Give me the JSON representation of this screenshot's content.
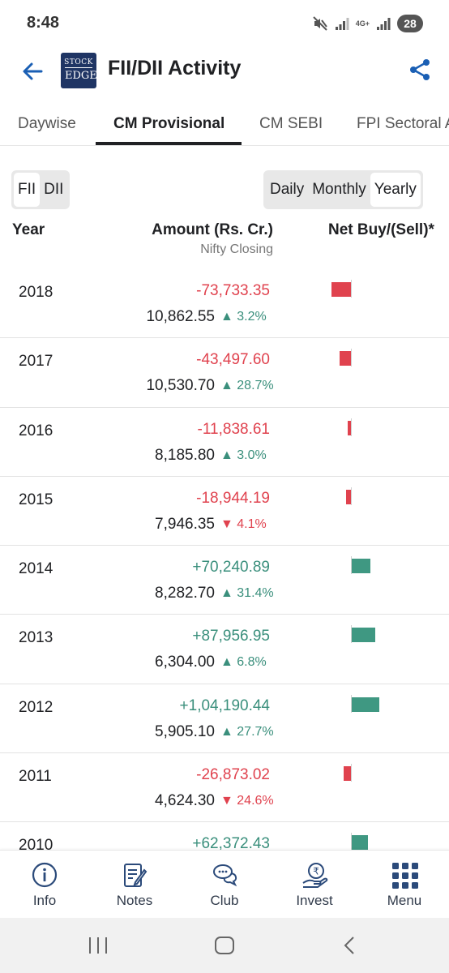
{
  "status": {
    "time": "8:48",
    "network": "4G+",
    "battery": "28"
  },
  "appbar": {
    "title": "FII/DII Activity",
    "logo_line1": "STOCK",
    "logo_line2": "EDGE"
  },
  "tabs": [
    {
      "label": "Daywise",
      "active": false
    },
    {
      "label": "CM Provisional",
      "active": true
    },
    {
      "label": "CM SEBI",
      "active": false
    },
    {
      "label": "FPI Sectoral Analysis",
      "active": false
    }
  ],
  "investor_toggle": {
    "options": [
      "FII",
      "DII"
    ],
    "selected": "FII"
  },
  "period_toggle": {
    "options": [
      "Daily",
      "Monthly",
      "Yearly"
    ],
    "selected": "Yearly"
  },
  "table": {
    "col_year": "Year",
    "col_amount": "Amount (Rs. Cr.)",
    "col_amount_sub": "Nifty Closing",
    "col_net": "Net Buy/(Sell)*",
    "rows": [
      {
        "year": "2018",
        "amount": "-73,733.35",
        "amount_value": -73733.35,
        "nifty": "10,862.55",
        "change": "▲ 3.2%",
        "direction": "up"
      },
      {
        "year": "2017",
        "amount": "-43,497.60",
        "amount_value": -43497.6,
        "nifty": "10,530.70",
        "change": "▲ 28.7%",
        "direction": "up"
      },
      {
        "year": "2016",
        "amount": "-11,838.61",
        "amount_value": -11838.61,
        "nifty": "8,185.80",
        "change": "▲ 3.0%",
        "direction": "up"
      },
      {
        "year": "2015",
        "amount": "-18,944.19",
        "amount_value": -18944.19,
        "nifty": "7,946.35",
        "change": "▼ 4.1%",
        "direction": "down"
      },
      {
        "year": "2014",
        "amount": "+70,240.89",
        "amount_value": 70240.89,
        "nifty": "8,282.70",
        "change": "▲ 31.4%",
        "direction": "up"
      },
      {
        "year": "2013",
        "amount": "+87,956.95",
        "amount_value": 87956.95,
        "nifty": "6,304.00",
        "change": "▲ 6.8%",
        "direction": "up"
      },
      {
        "year": "2012",
        "amount": "+1,04,190.44",
        "amount_value": 104190.44,
        "nifty": "5,905.10",
        "change": "▲ 27.7%",
        "direction": "up"
      },
      {
        "year": "2011",
        "amount": "-26,873.02",
        "amount_value": -26873.02,
        "nifty": "4,624.30",
        "change": "▼ 24.6%",
        "direction": "down"
      },
      {
        "year": "2010",
        "amount": "+62,372.43",
        "amount_value": 62372.43,
        "nifty": "",
        "change": "",
        "direction": "up"
      }
    ]
  },
  "bottom_nav": [
    {
      "label": "Info",
      "icon": "info-icon"
    },
    {
      "label": "Notes",
      "icon": "notes-icon"
    },
    {
      "label": "Club",
      "icon": "chat-icon"
    },
    {
      "label": "Invest",
      "icon": "rupee-hand-icon"
    },
    {
      "label": "Menu",
      "icon": "grid-menu-icon"
    }
  ],
  "colors": {
    "positive": "#3a8f7c",
    "negative": "#e0424e",
    "accent": "#1a5fb4"
  }
}
